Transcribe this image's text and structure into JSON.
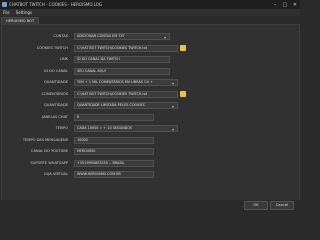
{
  "window": {
    "title": "CHATBOT TWITCH - COOKIES - HEROISMO.LOG"
  },
  "menu": {
    "file": "File",
    "settings": "Settings"
  },
  "tab": {
    "label": "HEROISMO BOT"
  },
  "fields": [
    {
      "label": "CONTAS",
      "value": "ADICIONAR CONTAS EM TXT",
      "type": "dropdown"
    },
    {
      "label": "COOKIES TWITCH",
      "value": "C:\\HAT BOT TWITCH\\COOKIES TWITCH.txt",
      "type": "file"
    },
    {
      "label": "LINK",
      "value": "ID DO CANAL DA TWITCH",
      "type": "text"
    },
    {
      "label": "ID DO CANAL",
      "value": "SEU CANAL AQUI",
      "type": "text"
    },
    {
      "label": "QUANTIDADE",
      "value": "TEN + 1 MIL COMENTÁRIOS EM LIBRAS OU +",
      "type": "dropdown"
    },
    {
      "label": "COMENTÁRIOS",
      "value": "C:\\HAT BOT TWITCH\\COOKIES TWITCH.txt",
      "type": "file"
    },
    {
      "label": "QUANTIDADE",
      "value": "QUANTIDADE LIMITADA PELOS COOKIES",
      "type": "dropdown"
    },
    {
      "label": "JANELAS CHAT",
      "value": "6",
      "type": "spin"
    },
    {
      "label": "TEMPO",
      "value": "CADA 10000 = + 10 SEGUNDOS",
      "type": "dropdown"
    },
    {
      "label": "TEMPO DAS MENSAGENS",
      "value": "10000",
      "type": "spin"
    },
    {
      "label": "CANAL DO YOUTUBE",
      "value": "HEROISMO",
      "type": "text"
    },
    {
      "label": "SUPORTE WHATSAPP",
      "value": "+5519994853355 -- BRASIL",
      "type": "text"
    },
    {
      "label": "LOJA VIRTUAL",
      "value": "WWW.HEROISMO.COM.BR",
      "type": "text"
    }
  ],
  "buttons": {
    "ok": "OK",
    "cancel": "Cancel"
  },
  "colors": {
    "folder": "#e8c24a",
    "background": "#2b2b2b"
  }
}
